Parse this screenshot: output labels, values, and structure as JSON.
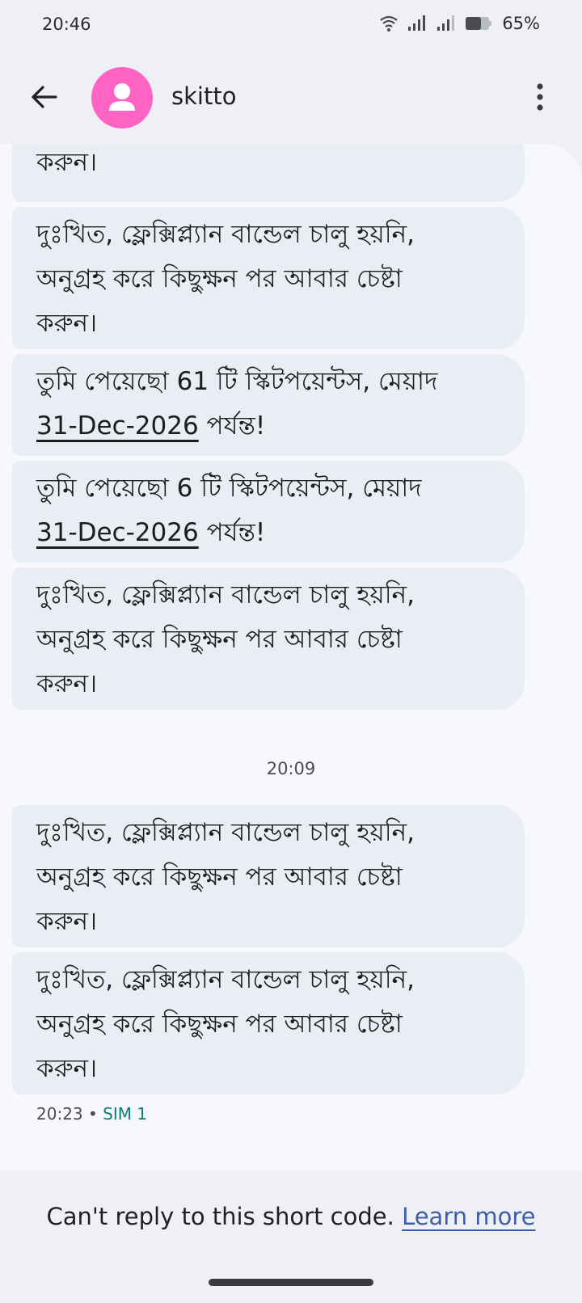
{
  "status_bar": {
    "time": "20:46",
    "battery": "65%"
  },
  "app_bar": {
    "contact_name": "skitto",
    "avatar_color": "#ff63c4"
  },
  "messages": [
    {
      "lines": [
        "করুন।"
      ]
    },
    {
      "lines": [
        "দুঃখিত, ফ্লেক্সিপ্ল্যান বান্ডেল চালু হয়নি,",
        "অনুগ্রহ করে কিছুক্ষন পর আবার চেষ্টা",
        "করুন।"
      ]
    },
    {
      "prefix": "তুমি পেয়েছো 61 টি স্কিটপয়েন্টস, মেয়াদ",
      "date": "31-Dec-2026",
      "suffix": " পর্যন্ত!"
    },
    {
      "prefix": "তুমি পেয়েছো 6 টি স্কিটপয়েন্টস, মেয়াদ",
      "date": "31-Dec-2026",
      "suffix": " পর্যন্ত!"
    },
    {
      "lines": [
        "দুঃখিত, ফ্লেক্সিপ্ল্যান বান্ডেল চালু হয়নি,",
        "অনুগ্রহ করে কিছুক্ষন পর আবার চেষ্টা",
        "করুন।"
      ]
    },
    {
      "lines": [
        "দুঃখিত, ফ্লেক্সিপ্ল্যান বান্ডেল চালু হয়নি,",
        "অনুগ্রহ করে কিছুক্ষন পর আবার চেষ্টা",
        "করুন।"
      ]
    },
    {
      "lines": [
        "দুঃখিত, ফ্লেক্সিপ্ল্যান বান্ডেল চালু হয়নি,",
        "অনুগ্রহ করে কিছুক্ষন পর আবার চেষ্টা",
        "করুন।"
      ]
    }
  ],
  "time_divider": "20:09",
  "last_message_meta": {
    "time": "20:23",
    "separator": "•",
    "sim": "SIM 1"
  },
  "footer": {
    "text": "Can't reply to this short code. ",
    "link": "Learn more"
  }
}
